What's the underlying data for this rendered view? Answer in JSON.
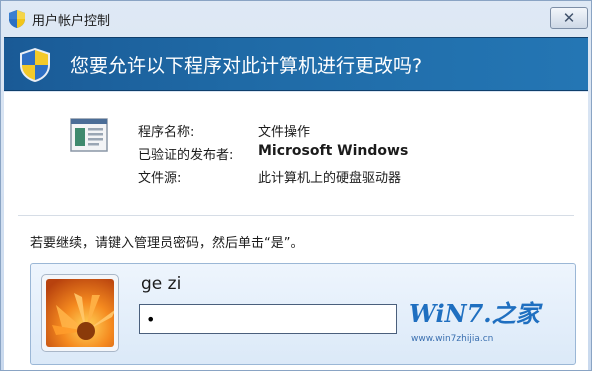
{
  "window": {
    "title": "用户帐户控制",
    "close_label": "✕"
  },
  "banner": {
    "question": "您要允许以下程序对此计算机进行更改吗?"
  },
  "details": {
    "program_name_label": "程序名称:",
    "program_name_value": "文件操作",
    "publisher_label": "已验证的发布者:",
    "publisher_value": "Microsoft Windows",
    "source_label": "文件源:",
    "source_value": "此计算机上的硬盘驱动器"
  },
  "credentials": {
    "prompt": "若要继续，请键入管理员密码，然后单击“是”。",
    "username": "ge zi",
    "password_value": "•"
  },
  "watermark": {
    "text": "WiN7.之家",
    "url": "www.win7zhijia.cn"
  },
  "icons": {
    "title_icon": "uac-shield-icon",
    "banner_icon": "uac-shield-icon",
    "program_icon": "program-window-icon",
    "avatar": "flower-avatar"
  },
  "colors": {
    "banner": "#1f6aa6",
    "title_bar": "#dfe9f5"
  }
}
